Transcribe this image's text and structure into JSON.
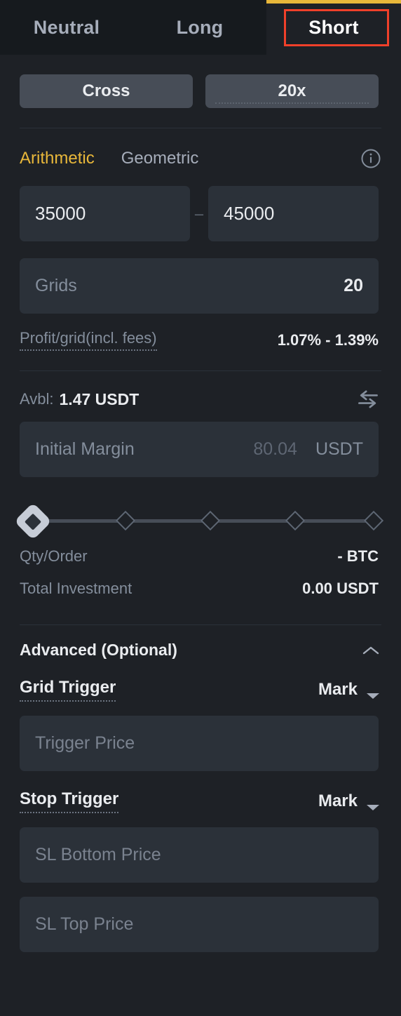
{
  "direction_tabs": {
    "items": [
      {
        "label": "Neutral",
        "active": false
      },
      {
        "label": "Long",
        "active": false
      },
      {
        "label": "Short",
        "active": true
      }
    ],
    "accent_color": "#e8b73a",
    "selection_ring_color": "#f0402a"
  },
  "mode": {
    "margin_mode": "Cross",
    "leverage": "20x"
  },
  "grid_mode": {
    "arithmetic": "Arithmetic",
    "geometric": "Geometric",
    "active": "Arithmetic",
    "info_icon": "info-icon"
  },
  "price_range": {
    "lower": "35000",
    "upper": "45000",
    "separator": "–"
  },
  "grids": {
    "label": "Grids",
    "value": "20"
  },
  "profit_per_grid": {
    "label": "Profit/grid(incl. fees)",
    "value": "1.07% - 1.39%"
  },
  "available": {
    "label": "Avbl:",
    "value": "1.47 USDT",
    "transfer_icon": "transfer-icon"
  },
  "initial_margin": {
    "label": "Initial Margin",
    "placeholder": "80.04",
    "unit": "USDT"
  },
  "slider": {
    "value": 0,
    "ticks": [
      0,
      25,
      50,
      75,
      100
    ]
  },
  "summary": [
    {
      "key": "Qty/Order",
      "value": "- BTC"
    },
    {
      "key": "Total Investment",
      "value": "0.00 USDT"
    }
  ],
  "advanced": {
    "title": "Advanced (Optional)",
    "expanded": true,
    "collapse_icon": "chevron-up-icon",
    "grid_trigger": {
      "label": "Grid Trigger",
      "source": "Mark",
      "caret_icon": "chevron-down-icon",
      "price_placeholder": "Trigger Price"
    },
    "stop_trigger": {
      "label": "Stop Trigger",
      "source": "Mark",
      "caret_icon": "chevron-down-icon",
      "sl_bottom_placeholder": "SL Bottom Price",
      "sl_top_placeholder": "SL Top Price"
    }
  }
}
